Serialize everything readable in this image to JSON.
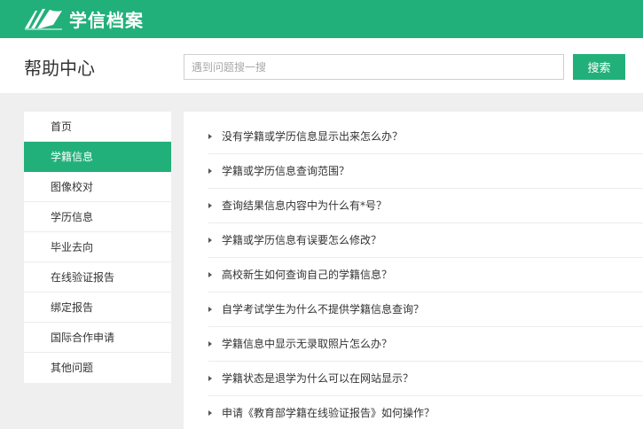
{
  "brand": {
    "name": "学信档案",
    "logo_icon": "book-logo-icon"
  },
  "header": {
    "title": "帮助中心",
    "search": {
      "placeholder": "遇到问题搜一搜",
      "value": "",
      "button_label": "搜索"
    }
  },
  "sidebar": {
    "items": [
      {
        "label": "首页",
        "active": false
      },
      {
        "label": "学籍信息",
        "active": true
      },
      {
        "label": "图像校对",
        "active": false
      },
      {
        "label": "学历信息",
        "active": false
      },
      {
        "label": "毕业去向",
        "active": false
      },
      {
        "label": "在线验证报告",
        "active": false
      },
      {
        "label": "绑定报告",
        "active": false
      },
      {
        "label": "国际合作申请",
        "active": false
      },
      {
        "label": "其他问题",
        "active": false
      }
    ]
  },
  "faq": {
    "items": [
      "没有学籍或学历信息显示出来怎么办？",
      "学籍或学历信息查询范围？",
      "查询结果信息内容中为什么有*号？",
      "学籍或学历信息有误要怎么修改？",
      "高校新生如何查询自己的学籍信息？",
      "自学考试学生为什么不提供学籍信息查询？",
      "学籍信息中显示无录取照片怎么办？",
      "学籍状态是退学为什么可以在网站显示？",
      "申请《教育部学籍在线验证报告》如何操作？"
    ]
  },
  "colors": {
    "accent": "#22b07a",
    "background": "#efefef",
    "panel": "#ffffff"
  }
}
